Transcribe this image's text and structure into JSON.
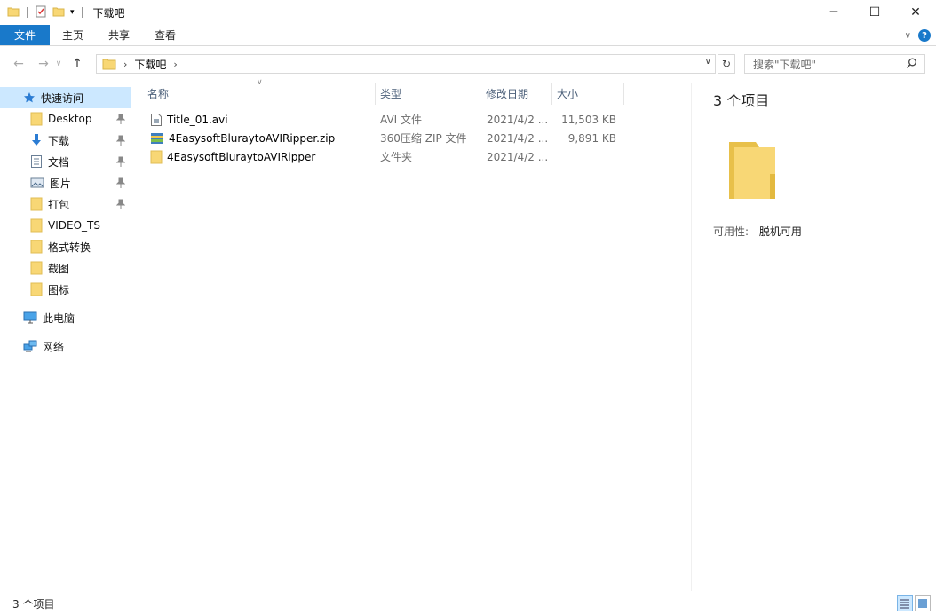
{
  "window": {
    "title": "下载吧",
    "controls": {
      "minimize": "─",
      "maximize": "☐",
      "close": "✕"
    }
  },
  "ribbon": {
    "tabs": [
      "文件",
      "主页",
      "共享",
      "查看"
    ]
  },
  "address": {
    "crumbs": [
      "下载吧"
    ],
    "search_placeholder": "搜索\"下载吧\""
  },
  "nav": {
    "quick_access": "快速访问",
    "pinned": [
      {
        "label": "Desktop",
        "icon": "folder-icon",
        "pinned": true
      },
      {
        "label": "下载",
        "icon": "download-arrow-icon",
        "pinned": true
      },
      {
        "label": "文档",
        "icon": "document-icon",
        "pinned": true
      },
      {
        "label": "图片",
        "icon": "picture-icon",
        "pinned": true
      },
      {
        "label": "打包",
        "icon": "folder-icon",
        "pinned": true
      },
      {
        "label": "VIDEO_TS",
        "icon": "folder-icon",
        "pinned": false
      },
      {
        "label": "格式转换",
        "icon": "folder-icon",
        "pinned": false
      },
      {
        "label": "截图",
        "icon": "folder-icon",
        "pinned": false
      },
      {
        "label": "图标",
        "icon": "folder-icon",
        "pinned": false
      }
    ],
    "this_pc": "此电脑",
    "network": "网络"
  },
  "files": {
    "columns": {
      "name": "名称",
      "type": "类型",
      "date": "修改日期",
      "size": "大小"
    },
    "rows": [
      {
        "name": "Title_01.avi",
        "type": "AVI 文件",
        "date": "2021/4/2 ...",
        "size": "11,503 KB",
        "icon": "video-file-icon"
      },
      {
        "name": "4EasysoftBluraytoAVIRipper.zip",
        "type": "360压缩 ZIP 文件",
        "date": "2021/4/2 ...",
        "size": "9,891 KB",
        "icon": "zip-archive-icon"
      },
      {
        "name": "4EasysoftBluraytoAVIRipper",
        "type": "文件夹",
        "date": "2021/4/2 ...",
        "size": "",
        "icon": "folder-icon"
      }
    ]
  },
  "details": {
    "count": "3 个项目",
    "availability_label": "可用性:",
    "availability_value": "脱机可用"
  },
  "status": {
    "item_count": "3 个项目"
  },
  "colors": {
    "accent": "#1979ca",
    "selection": "#cce8ff",
    "folder": "#f8d775"
  }
}
